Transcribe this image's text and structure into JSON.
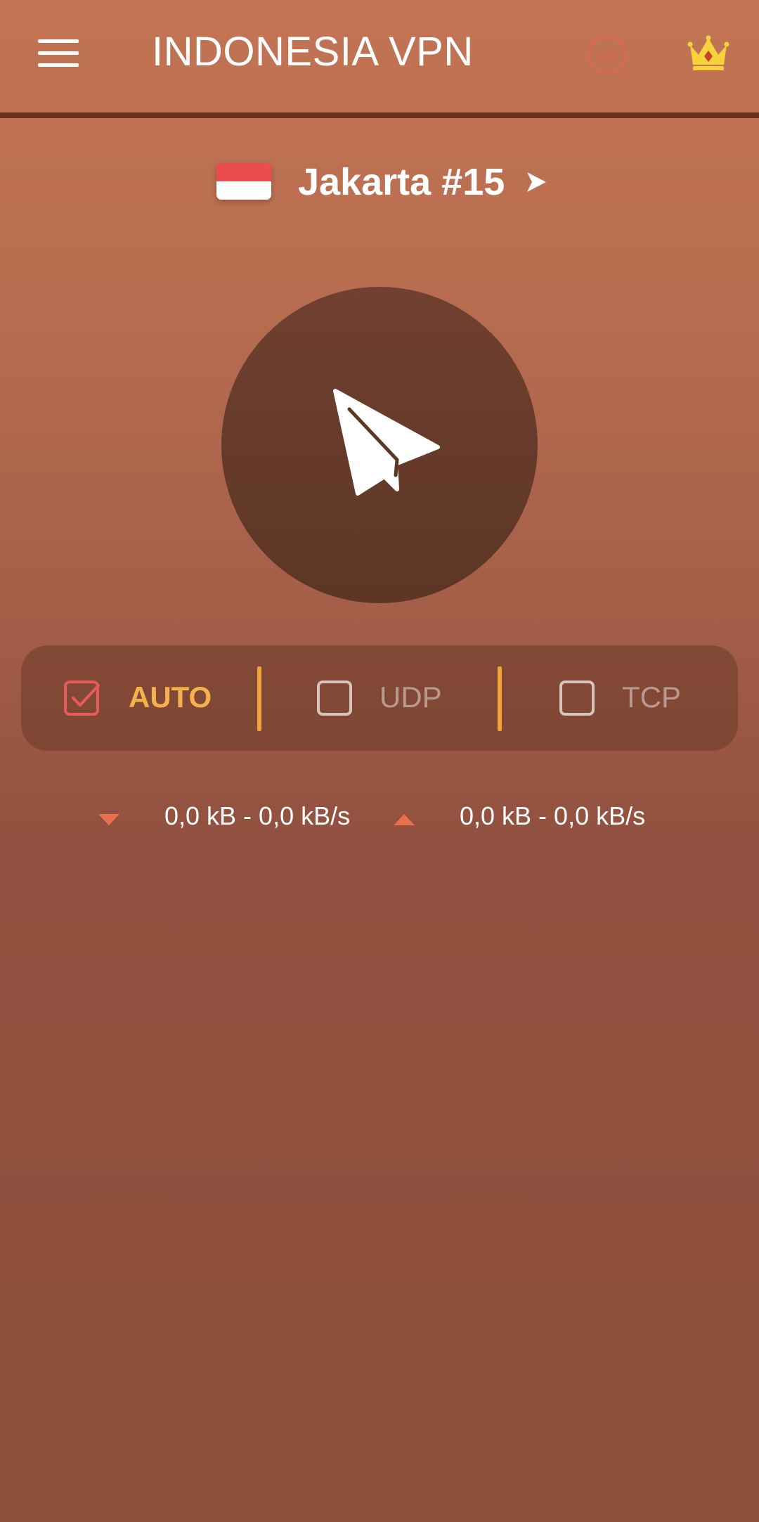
{
  "appbar": {
    "title": "INDONESIA VPN",
    "icons": [
      "hamburger-menu-icon",
      "ad-icon",
      "crown-icon"
    ]
  },
  "server": {
    "country_flag": "indonesia-flag",
    "name": "Jakarta #15"
  },
  "connect": {
    "icon": "paper-plane-icon"
  },
  "protocols": {
    "auto": {
      "label": "AUTO",
      "checked": true
    },
    "udp": {
      "label": "UDP",
      "checked": false
    },
    "tcp": {
      "label": "TCP",
      "checked": false
    }
  },
  "traffic": {
    "download": "0,0 kB - 0,0 kB/s",
    "upload": "0,0 kB - 0,0 kB/s"
  },
  "colors": {
    "accent": "#f0a23c",
    "auto_check": "#e85a5a",
    "traffic_arrow": "#e8704c",
    "crown": "#f6d33b"
  }
}
